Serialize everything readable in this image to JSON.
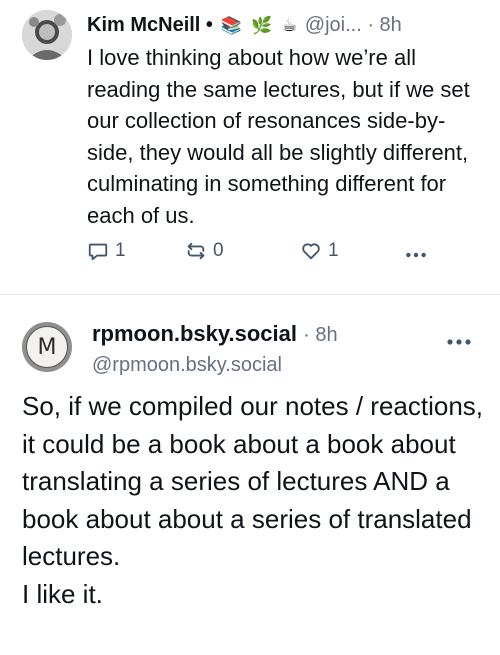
{
  "post1": {
    "author_name": "Kim McNeill",
    "emojis": [
      "📚",
      "🌿",
      "☕"
    ],
    "handle": "@joi...",
    "time": "· 8h",
    "text": "I love thinking about how we’re all reading the same lectures, but if we set our collection of resonances side-by-side, they would all be slightly different, culminating in something different for each of us.",
    "reply_count": "1",
    "repost_count": "0",
    "like_count": "1",
    "icons": {
      "reply": "reply-icon",
      "repost": "repost-icon",
      "like": "heart-icon",
      "more": "more-icon"
    }
  },
  "post2": {
    "avatar_letter": "M",
    "author_name": "rpmoon.bsky.social",
    "time": "· 8h",
    "handle": "@rpmoon.bsky.social",
    "text": "So, if we compiled our notes / reactions, it could be a book about a book about translating a series of lectures AND a book about about a series of translated lectures.",
    "text2": "I like it."
  },
  "colors": {
    "text": "#0f1419",
    "muted": "#66717f",
    "action": "#42576c",
    "divider": "#e3e6ea"
  }
}
